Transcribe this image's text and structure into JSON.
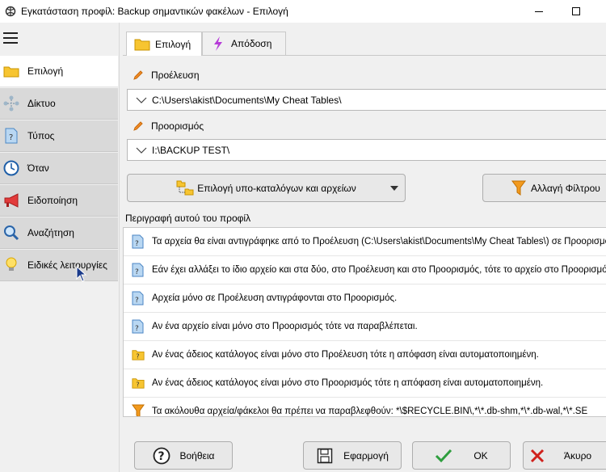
{
  "window": {
    "title": "Εγκατάσταση προφίλ: Backup σημαντικών φακέλων - Επιλογή"
  },
  "sidebar": {
    "items": [
      {
        "label": "Επιλογή",
        "icon": "folder-icon",
        "active": true
      },
      {
        "label": "Δίκτυο",
        "icon": "network-icon",
        "active": false
      },
      {
        "label": "Τύπος",
        "icon": "document-question-icon",
        "active": false
      },
      {
        "label": "Όταν",
        "icon": "clock-icon",
        "active": false
      },
      {
        "label": "Ειδοποίηση",
        "icon": "megaphone-icon",
        "active": false
      },
      {
        "label": "Αναζήτηση",
        "icon": "magnifier-icon",
        "active": false
      },
      {
        "label": "Ειδικές λειτουργίες",
        "icon": "lightbulb-icon",
        "active": false
      }
    ]
  },
  "tabs": [
    {
      "label": "Επιλογή",
      "icon": "folder-icon",
      "active": true
    },
    {
      "label": "Απόδοση",
      "icon": "lightning-icon",
      "active": false
    }
  ],
  "source": {
    "label": "Προέλευση",
    "value": "C:\\Users\\akist\\Documents\\My Cheat Tables\\"
  },
  "destination": {
    "label": "Προορισμός",
    "value": "I:\\BACKUP TEST\\"
  },
  "buttons": {
    "select_subfolders": "Επιλογή υπο-καταλόγων και αρχείων",
    "change_filter": "Αλλαγή Φίλτρου",
    "help": "Βοήθεια",
    "apply": "Εφαρμογή",
    "ok": "OK",
    "cancel": "Άκυρο"
  },
  "description": {
    "title": "Περιγραφή αυτού του προφίλ",
    "rows": [
      {
        "icon": "document-question-icon",
        "text": "Τα αρχεία θα είναι αντιγράφηκε από το Προέλευση (C:\\Users\\akist\\Documents\\My Cheat Tables\\) σε Προορισμός"
      },
      {
        "icon": "document-question-icon",
        "text": "Εάν έχει αλλάξει το ίδιο αρχείο και στα δύο, στο Προέλευση και στο Προορισμός, τότε το αρχείο στο Προορισμός"
      },
      {
        "icon": "document-question-icon",
        "text": "Αρχεία μόνο σε Προέλευση αντιγράφονται στο Προορισμός."
      },
      {
        "icon": "document-question-icon",
        "text": "Αν ένα αρχείο είναι μόνο στο Προορισμός τότε να παραβλέπεται."
      },
      {
        "icon": "folder-question-icon",
        "text": "Αν ένας άδειος κατάλογος είναι μόνο στο Προέλευση τότε η απόφαση είναι αυτοματοποιημένη."
      },
      {
        "icon": "folder-question-icon",
        "text": "Αν ένας άδειος κατάλογος είναι μόνο στο Προορισμός τότε η απόφαση είναι αυτοματοποιημένη."
      },
      {
        "icon": "filter-icon",
        "text": "Τα ακόλουθα αρχεία/φάκελοι θα πρέπει να παραβλεφθούν: *\\$RECYCLE.BIN\\,*\\*.db-shm,*\\*.db-wal,*\\*.SE"
      }
    ]
  },
  "colors": {
    "accent_folder": "#f5b800",
    "ok_check": "#2e9e3e",
    "cancel_x": "#d0211c",
    "tab_lightning": "#b63cd8"
  }
}
